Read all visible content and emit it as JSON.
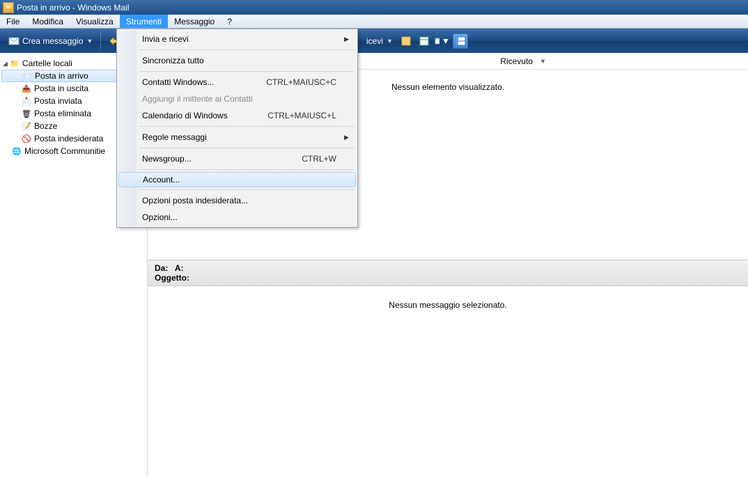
{
  "title": "Posta in arrivo - Windows Mail",
  "menubar": [
    "File",
    "Modifica",
    "Visualizza",
    "Strumenti",
    "Messaggio",
    "?"
  ],
  "activeMenuIdx": 3,
  "toolbar": {
    "compose": "Crea messaggio",
    "sendrecv_partial": "icevi"
  },
  "tree": {
    "root": "Cartelle locali",
    "items": [
      {
        "label": "Posta in arrivo",
        "selected": true,
        "glyph": "📨"
      },
      {
        "label": "Posta in uscita",
        "glyph": "📤"
      },
      {
        "label": "Posta inviata",
        "glyph": "📩"
      },
      {
        "label": "Posta eliminata",
        "glyph": "🗑"
      },
      {
        "label": "Bozze",
        "glyph": "📝"
      },
      {
        "label": "Posta indesiderata",
        "glyph": "🚫"
      }
    ],
    "extra": "Microsoft Communitie"
  },
  "columns": {
    "received": "Ricevuto"
  },
  "list_empty": "Nessun elemento visualizzato.",
  "preview": {
    "from": "Da:",
    "to": "A:",
    "subject": "Oggetto:",
    "empty": "Nessun messaggio selezionato."
  },
  "dropdown": [
    {
      "label": "Invia e ricevi",
      "sub": true
    },
    {
      "sep": true
    },
    {
      "label": "Sincronizza tutto"
    },
    {
      "sep": true
    },
    {
      "label": "Contatti Windows...",
      "short": "CTRL+MAIUSC+C"
    },
    {
      "label": "Aggiungi il mittente ai Contatti",
      "disabled": true
    },
    {
      "label": "Calendario di Windows",
      "short": "CTRL+MAIUSC+L"
    },
    {
      "sep": true
    },
    {
      "label": "Regole messaggi",
      "sub": true
    },
    {
      "sep": true
    },
    {
      "label": "Newsgroup...",
      "short": "CTRL+W"
    },
    {
      "sep": true
    },
    {
      "label": "Account...",
      "hl": true
    },
    {
      "sep": true
    },
    {
      "label": "Opzioni posta indesiderata..."
    },
    {
      "label": "Opzioni..."
    }
  ]
}
